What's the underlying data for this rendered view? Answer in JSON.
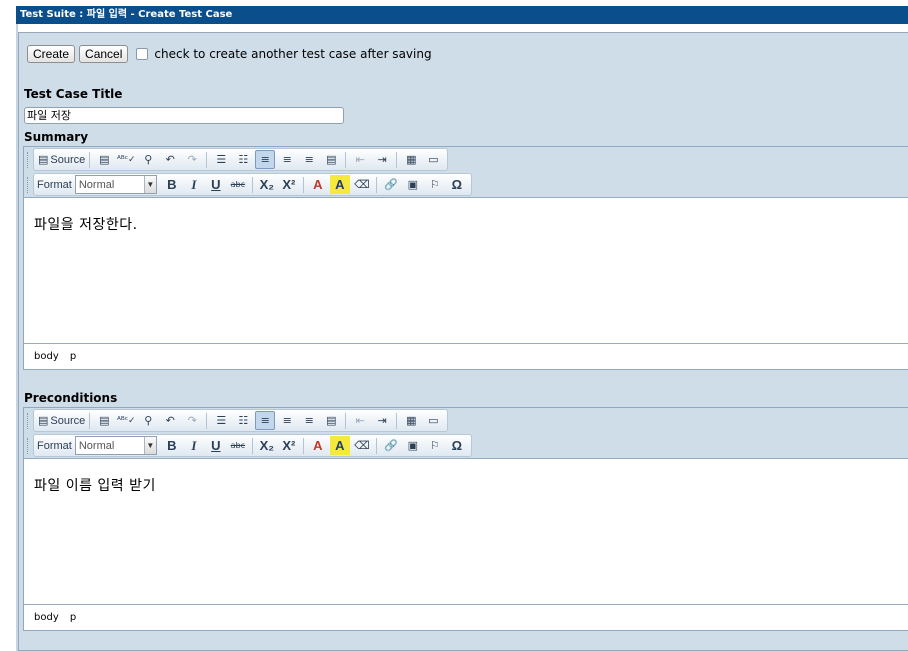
{
  "window": {
    "title": "Test Suite : 파일 입력 - Create Test Case"
  },
  "actions": {
    "create_label": "Create",
    "cancel_label": "Cancel",
    "checkbox_label": "check to create another test case after saving"
  },
  "fields": {
    "title_label": "Test Case Title",
    "title_value": "파일 저장",
    "summary_label": "Summary",
    "preconditions_label": "Preconditions"
  },
  "toolbar": {
    "source_label": "Source",
    "format_label": "Format",
    "format_value": "Normal",
    "bold": "B",
    "italic": "I",
    "underline": "U",
    "strike": "abc",
    "subscript": "X₂",
    "superscript": "X²",
    "text_color": "A",
    "bg_color": "A",
    "icons": [
      "source-icon",
      "templates-icon",
      "spellcheck-icon",
      "find-icon",
      "undo-icon",
      "redo-icon",
      "numbered-list-icon",
      "bulleted-list-icon",
      "align-left-icon",
      "align-center-icon",
      "align-right-icon",
      "justify-icon",
      "outdent-icon",
      "indent-icon",
      "table-icon",
      "horizontal-rule-icon",
      "eraser-icon",
      "link-icon",
      "image-icon",
      "flag-icon",
      "omega-icon"
    ]
  },
  "editors": {
    "summary": {
      "content": "파일을 저장한다.",
      "path": [
        "body",
        "p"
      ]
    },
    "preconditions": {
      "content": "파일 이름 입력 받기",
      "path": [
        "body",
        "p"
      ]
    }
  },
  "colors": {
    "title_bar": "#0a4f8c",
    "panel": "#cfdde9"
  }
}
